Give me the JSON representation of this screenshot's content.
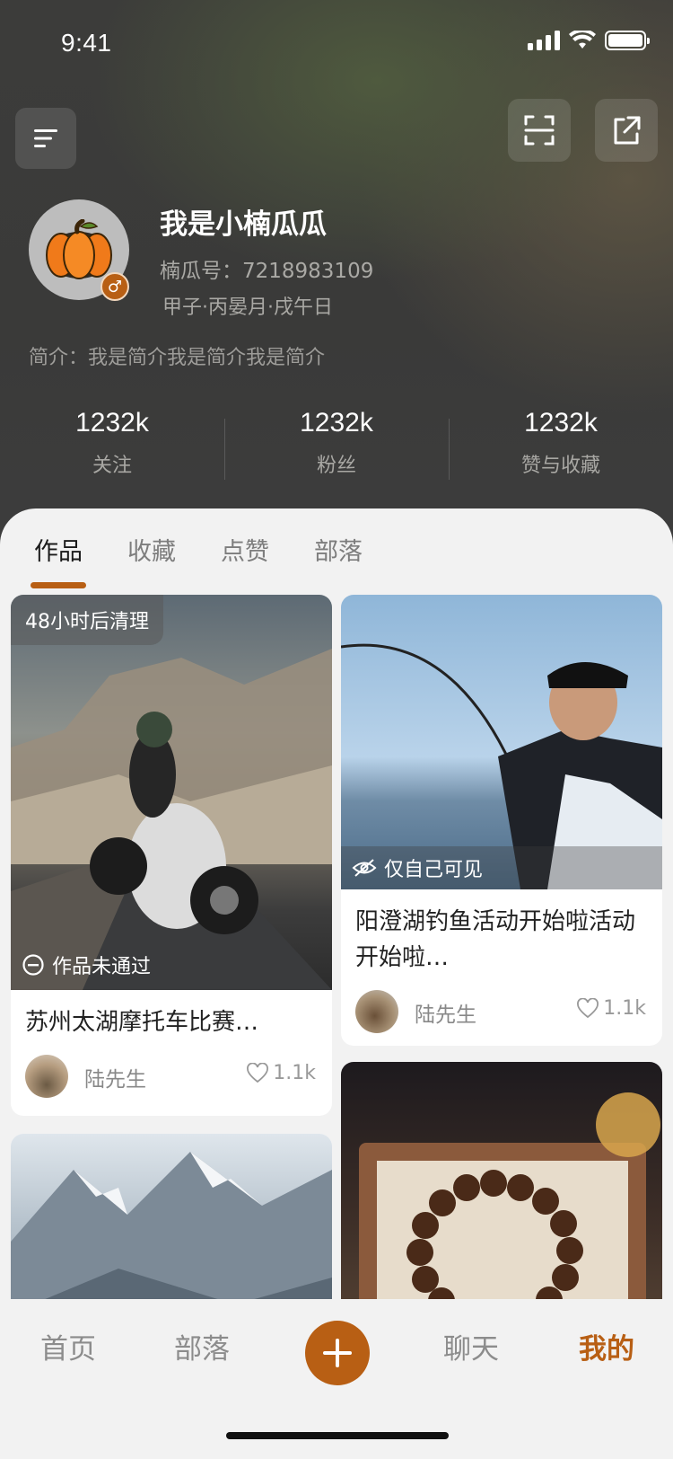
{
  "status_bar": {
    "time": "9:41"
  },
  "profile": {
    "nickname": "我是小楠瓜瓜",
    "user_id_label": "楠瓜号：7218983109",
    "bazi": "甲子·丙晏月·戌午日",
    "bio": "简介：我是简介我是简介我是简介",
    "gender_symbol": "♂"
  },
  "stats": [
    {
      "value": "1232k",
      "label": "关注"
    },
    {
      "value": "1232k",
      "label": "粉丝"
    },
    {
      "value": "1232k",
      "label": "赞与收藏"
    }
  ],
  "tabs": [
    {
      "label": "作品",
      "active": true
    },
    {
      "label": "收藏",
      "active": false
    },
    {
      "label": "点赞",
      "active": false
    },
    {
      "label": "部落",
      "active": false
    }
  ],
  "cards": [
    {
      "badge": "48小时后清理",
      "status": "作品未通过",
      "title": "苏州太湖摩托车比赛…",
      "author": "陆先生",
      "likes": "1.1k"
    },
    {
      "visibility": "仅自己可见",
      "title": "阳澄湖钓鱼活动开始啦活动开始啦…",
      "author": "陆先生",
      "likes": "1.1k"
    }
  ],
  "tabbar": [
    {
      "label": "首页",
      "active": false
    },
    {
      "label": "部落",
      "active": false
    },
    {
      "label": "聊天",
      "active": false
    },
    {
      "label": "我的",
      "active": true
    }
  ],
  "colors": {
    "accent": "#b85f14",
    "header_bg": "#3c3c3a"
  }
}
